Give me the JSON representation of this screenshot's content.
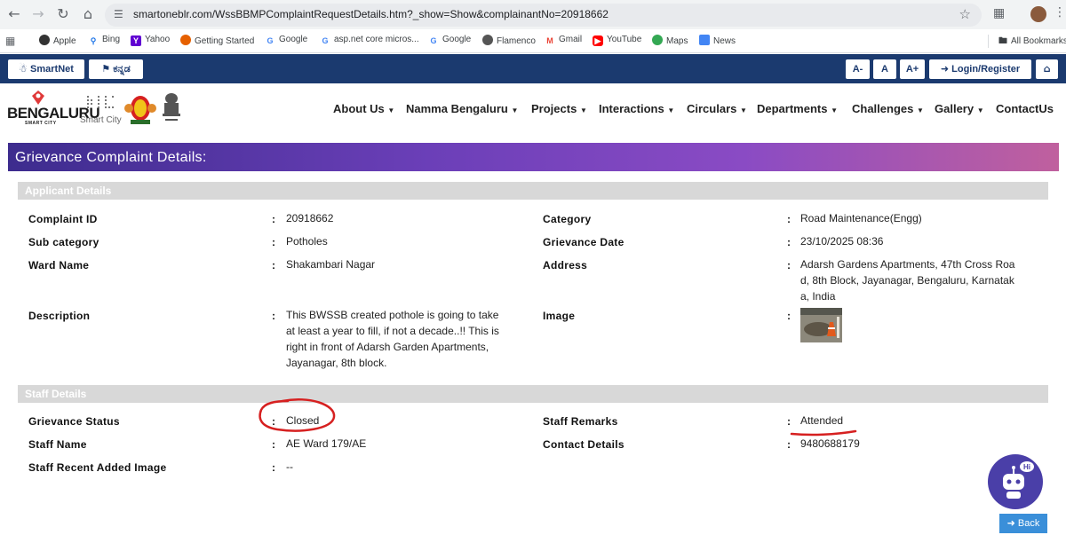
{
  "browser": {
    "url": "smartoneblr.com/WssBBMPComplaintRequestDetails.htm?_show=Show&complainantNo=20918662",
    "bookmarks": [
      "Apple",
      "Bing",
      "Yahoo",
      "Getting Started",
      "Google",
      "asp.net core micros...",
      "Google",
      "Flamenco",
      "Gmail",
      "YouTube",
      "Maps",
      "News"
    ],
    "all_bookmarks": "All Bookmarks"
  },
  "topbar": {
    "smartnet": "SmartNet",
    "kannada": "ಕನ್ನಡ",
    "font_small": "A-",
    "font_normal": "A",
    "font_large": "A+",
    "login": "Login/Register"
  },
  "header": {
    "logo_text": "BENGALURU",
    "logo_sub": "SMART CITY",
    "smart_city": "Smart City",
    "nav": [
      "About Us",
      "Namma Bengaluru",
      "Projects",
      "Interactions",
      "Circulars",
      "Departments",
      "Challenges",
      "Gallery",
      "ContactUs"
    ]
  },
  "page": {
    "title": "Grievance Complaint Details:",
    "applicant_section": "Applicant Details",
    "staff_section": "Staff Details",
    "back": "Back"
  },
  "applicant": {
    "complaint_id_label": "Complaint ID",
    "complaint_id": "20918662",
    "category_label": "Category",
    "category": "Road Maintenance(Engg)",
    "subcategory_label": "Sub category",
    "subcategory": "Potholes",
    "grievance_date_label": "Grievance Date",
    "grievance_date": "23/10/2025 08:36",
    "ward_label": "Ward Name",
    "ward": "Shakambari Nagar",
    "address_label": "Address",
    "address_lines": [
      "Adarsh Gardens Apartments, 47th Cross Roa",
      "d, 8th Block, Jayanagar, Bengaluru, Karnatak",
      "a, India"
    ],
    "description_label": "Description",
    "description_lines": [
      "This BWSSB created pothole is going to take",
      "at least a year to fill, if not a decade..!! This is",
      "right in front of Adarsh Garden Apartments,",
      "Jayanagar, 8th block."
    ],
    "image_label": "Image"
  },
  "staff": {
    "status_label": "Grievance Status",
    "status": "Closed",
    "remarks_label": "Staff Remarks",
    "remarks": "Attended",
    "name_label": "Staff Name",
    "name": "AE Ward 179/AE",
    "contact_label": "Contact Details",
    "contact": "9480688179",
    "recent_image_label": "Staff Recent Added Image",
    "recent_image": "--"
  },
  "chatbot": {
    "greeting": "Hi"
  },
  "colors": {
    "topbar": "#1b3a6f",
    "annotation": "#d62020",
    "back_button": "#3a8fd9"
  }
}
